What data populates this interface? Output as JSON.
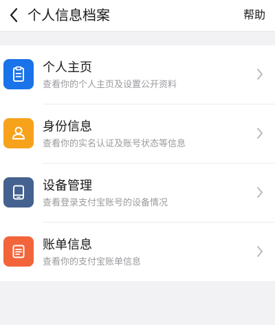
{
  "header": {
    "title": "个人信息档案",
    "help_label": "帮助",
    "back_icon": "chevron-left-icon"
  },
  "menu": {
    "items": [
      {
        "title": "个人主页",
        "description": "查看你的个人主页及设置公开资料",
        "icon": "clipboard-icon",
        "icon_color": "#1a73e8"
      },
      {
        "title": "身份信息",
        "description": "查看你的实名认证及账号状态等信息",
        "icon": "person-icon",
        "icon_color": "#f7a21b"
      },
      {
        "title": "设备管理",
        "description": "查看登录支付宝账号的设备情况",
        "icon": "tablet-icon",
        "icon_color": "#45618f"
      },
      {
        "title": "账单信息",
        "description": "查看你的支付宝账单信息",
        "icon": "bill-icon",
        "icon_color": "#f2643a"
      }
    ]
  },
  "colors": {
    "background": "#f2f2f4",
    "card": "#ffffff",
    "primary_text": "#1a1a1a",
    "secondary_text": "#9a9a9e",
    "chevron": "#b5b5b9"
  }
}
